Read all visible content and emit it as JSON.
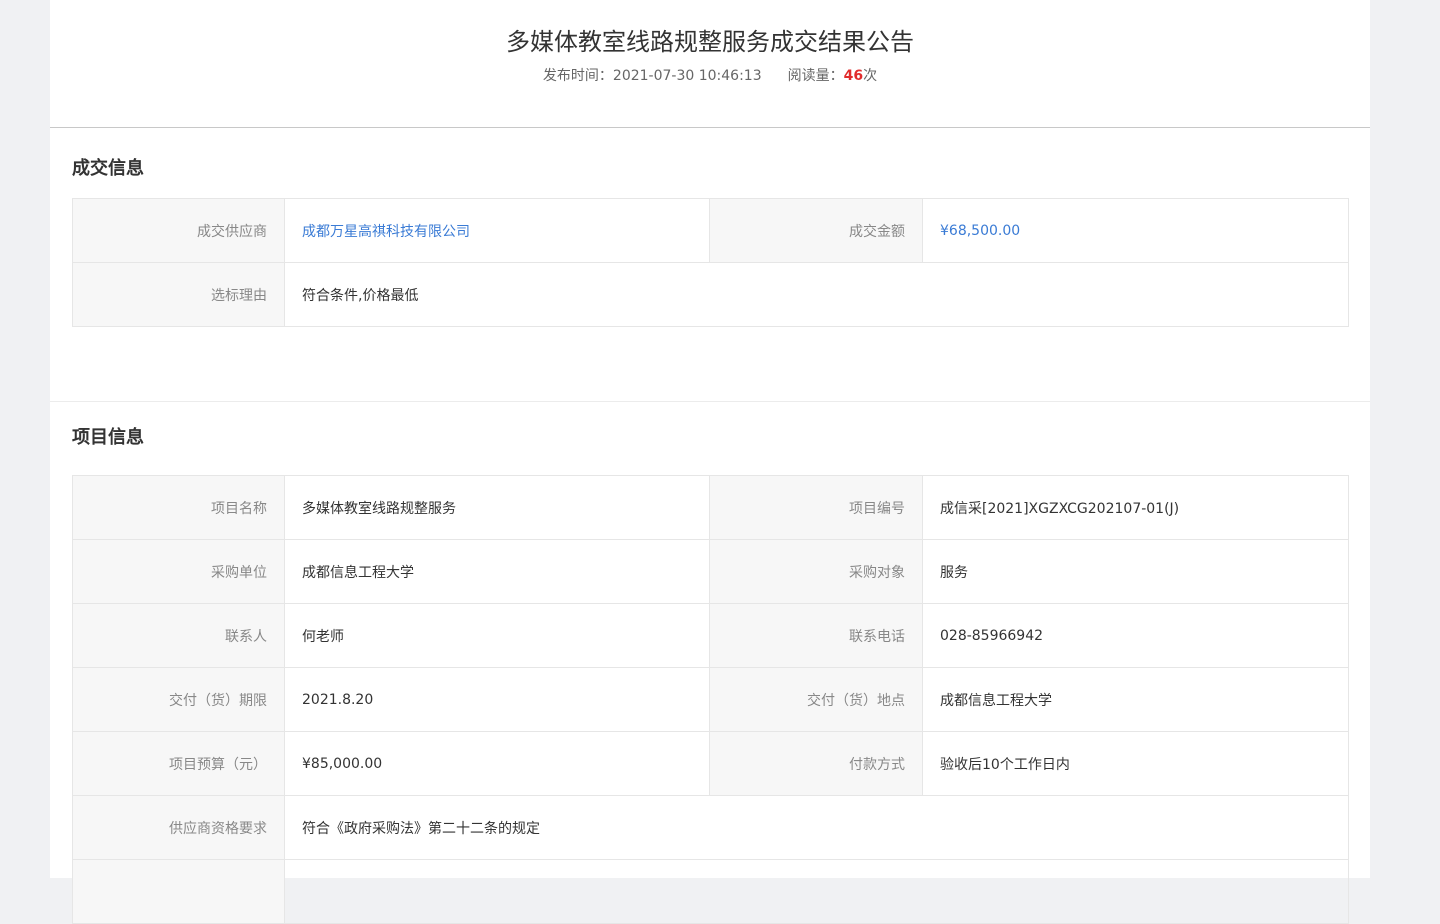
{
  "header": {
    "title": "多媒体教室线路规整服务成交结果公告",
    "publish_label": "发布时间：",
    "publish_time": "2021-07-30 10:46:13",
    "reads_label": "阅读量：",
    "reads_count": "46",
    "reads_unit": "次"
  },
  "deal_info": {
    "title": "成交信息",
    "supplier_label": "成交供应商",
    "supplier_value": "成都万星高祺科技有限公司",
    "amount_label": "成交金额",
    "amount_value": "¥68,500.00",
    "reason_label": "选标理由",
    "reason_value": "符合条件,价格最低"
  },
  "project_info": {
    "title": "项目信息",
    "name_label": "项目名称",
    "name_value": "多媒体教室线路规整服务",
    "code_label": "项目编号",
    "code_value": "成信采[2021]XGZXCG202107-01(J)",
    "buyer_label": "采购单位",
    "buyer_value": "成都信息工程大学",
    "object_label": "采购对象",
    "object_value": "服务",
    "contact_label": "联系人",
    "contact_value": "何老师",
    "phone_label": "联系电话",
    "phone_value": "028-85966942",
    "period_label": "交付（货）期限",
    "period_value": "2021.8.20",
    "place_label": "交付（货）地点",
    "place_value": "成都信息工程大学",
    "budget_label": "项目预算（元）",
    "budget_value": "¥85,000.00",
    "payment_label": "付款方式",
    "payment_value": "验收后10个工作日内",
    "qual_label": "供应商资格要求",
    "qual_value": "符合《政府采购法》第二十二条的规定"
  }
}
